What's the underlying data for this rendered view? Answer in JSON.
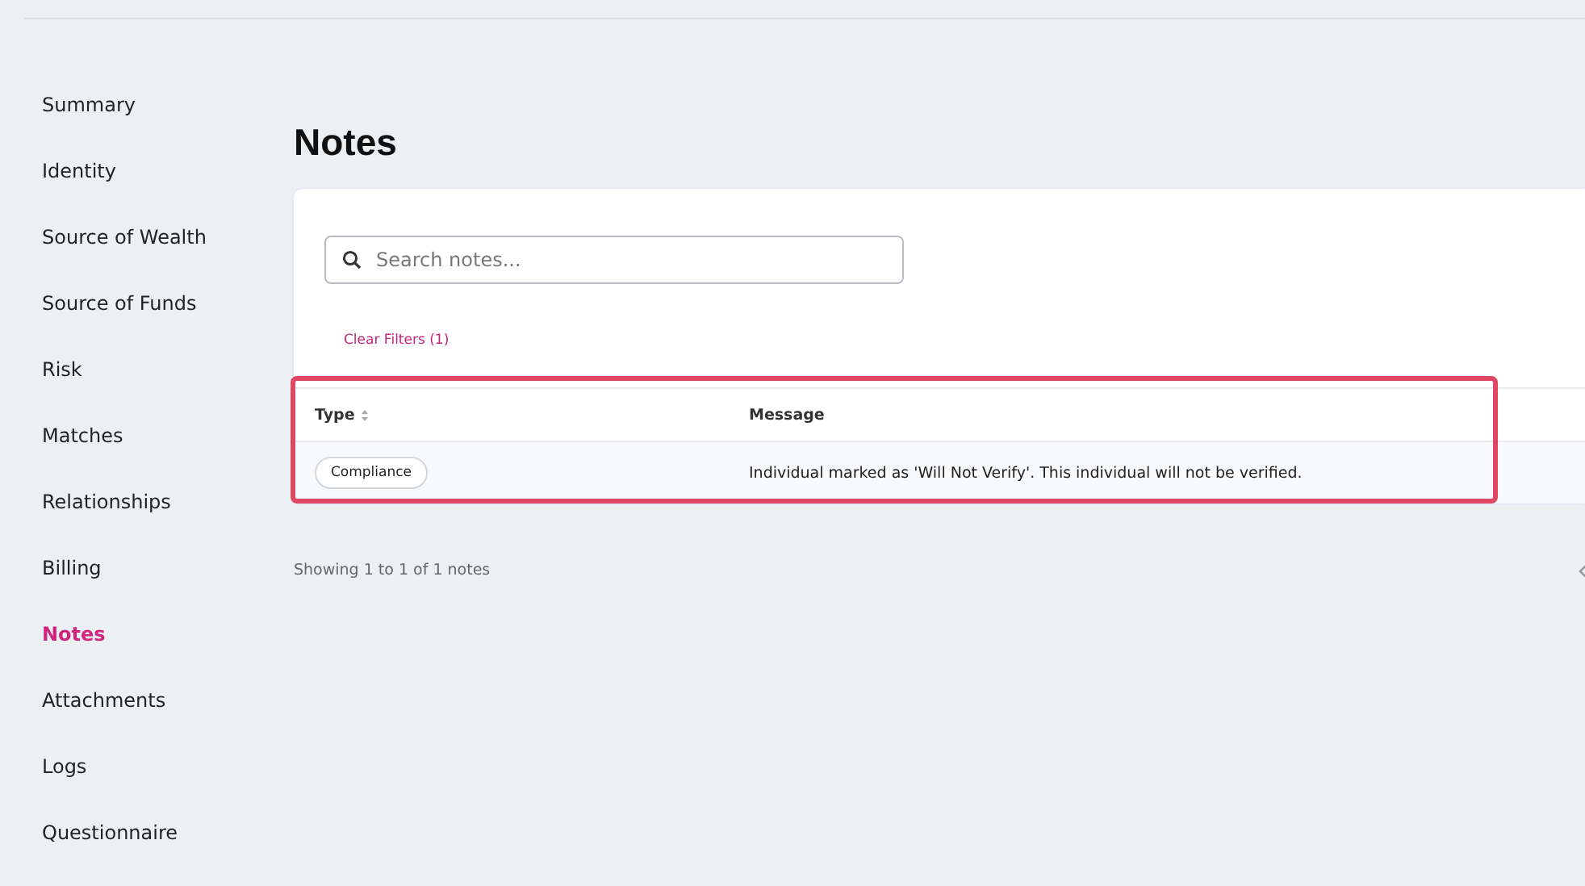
{
  "sidebar": {
    "items": [
      {
        "label": "Summary",
        "selected": false
      },
      {
        "label": "Identity",
        "selected": false
      },
      {
        "label": "Source of Wealth",
        "selected": false
      },
      {
        "label": "Source of Funds",
        "selected": false
      },
      {
        "label": "Risk",
        "selected": false
      },
      {
        "label": "Matches",
        "selected": false
      },
      {
        "label": "Relationships",
        "selected": false
      },
      {
        "label": "Billing",
        "selected": false
      },
      {
        "label": "Notes",
        "selected": true
      },
      {
        "label": "Attachments",
        "selected": false
      },
      {
        "label": "Logs",
        "selected": false
      },
      {
        "label": "Questionnaire",
        "selected": false
      }
    ]
  },
  "page_title": "Notes",
  "search": {
    "placeholder": "Search notes..."
  },
  "clear_filters": "Clear Filters (1)",
  "table": {
    "columns": [
      {
        "label": "Type",
        "sortable": true
      },
      {
        "label": "Message",
        "sortable": false
      }
    ],
    "rows": [
      {
        "type": "Compliance",
        "message": "Individual marked as 'Will Not Verify'. This individual will not be verified."
      }
    ]
  },
  "highlight": true,
  "footer": "Showing 1 to 1 of 1 notes"
}
